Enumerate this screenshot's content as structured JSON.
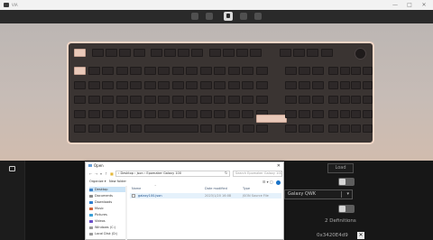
{
  "app": {
    "title": "VIA",
    "minimize_glyph": "—",
    "maximize_glyph": "□",
    "close_glyph": "✕"
  },
  "toolbar": {
    "icons": [
      "keymap-icon",
      "lighting-icon",
      "configure-icon",
      "settings-icon",
      "debug-icon"
    ],
    "active_icon": "configure-icon"
  },
  "colors": {
    "case_border": "#f0d6c6",
    "accent_keycap": "#e9c9b9",
    "dark_keycap": "#2d2828"
  },
  "configure": {
    "load_button": "Load",
    "keyboard_select": "Galaxy QWK",
    "definitions_count": "2 Definitions",
    "vid_pid": "0x3420E4d9"
  },
  "dialog": {
    "title": "Open",
    "address_path": "› Desktop › json › Epomaker Galaxy 100",
    "search_placeholder": "Search Epomaker Galaxy 100",
    "organize_label": "Organize ▾",
    "new_folder_label": "New folder",
    "nav_items": [
      "Desktop",
      "Documents",
      "Downloads",
      "Music",
      "Pictures",
      "Videos",
      "Windows (C:)",
      "Local Disk (D:)"
    ],
    "columns": [
      "Name",
      "Date modified",
      "Type"
    ],
    "files": [
      {
        "name": "galaxy100.json",
        "date": "2023/1/20 16:08",
        "type": "JSON Source File"
      }
    ]
  }
}
